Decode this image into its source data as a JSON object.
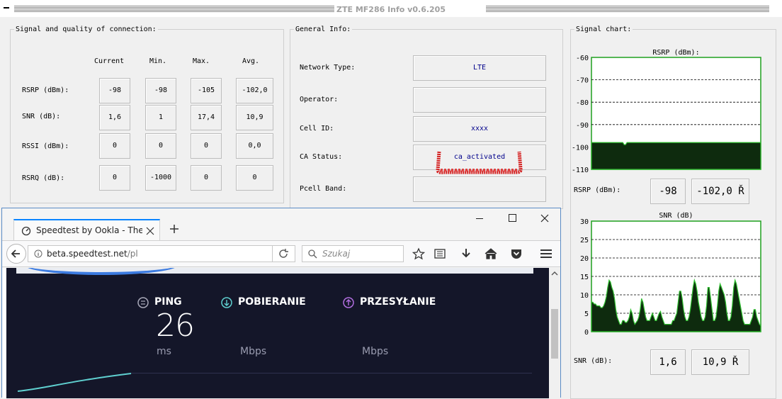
{
  "app": {
    "title": "ZTE MF286 Info v0.6.205"
  },
  "signal_group": {
    "title": "Signal and quality of connection:",
    "columns": [
      "Current",
      "Min.",
      "Max.",
      "Avg."
    ],
    "rows": [
      {
        "label": "RSRP (dBm):",
        "values": [
          "-98",
          "-98",
          "-105",
          "-102,0"
        ]
      },
      {
        "label": "SNR (dB):",
        "values": [
          "1,6",
          "1",
          "17,4",
          "10,9"
        ]
      },
      {
        "label": "RSSI (dBm):",
        "values": [
          "0",
          "0",
          "0",
          "0,0"
        ]
      },
      {
        "label": "RSRQ (dB):",
        "values": [
          "0",
          "-1000",
          "0",
          "0"
        ]
      }
    ]
  },
  "general_group": {
    "title": "General Info:",
    "fields": [
      {
        "label": "Network Type:",
        "value": "LTE"
      },
      {
        "label": "Operator:",
        "value": ""
      },
      {
        "label": "Cell ID:",
        "value": "xxxx"
      },
      {
        "label": "CA Status:",
        "value": "ca_activated"
      },
      {
        "label": "Pcell Band:",
        "value": ""
      }
    ]
  },
  "chart_group": {
    "title": "Signal chart:",
    "rsrp_row": {
      "label": "RSRP (dBm):",
      "current": "-98",
      "avg": "-102,0 Ř"
    },
    "snr_row": {
      "label": "SNR (dB):",
      "current": "1,6",
      "avg": "10,9 Ř"
    }
  },
  "chart_data": [
    {
      "type": "area",
      "title": "RSRP (dBm):",
      "ylim": [
        -110,
        -60
      ],
      "y_ticks": [
        "-60",
        "-70",
        "-80",
        "-90",
        "-100",
        "-110"
      ],
      "y_tick_values": [
        -60,
        -70,
        -80,
        -90,
        -100,
        -110
      ],
      "grid": "dashed",
      "fill_color": "#0e2b0e",
      "line_color": "#2fbf2f",
      "values": [
        -98,
        -98,
        -98,
        -98,
        -98,
        -98,
        -98,
        -98,
        -98,
        -98,
        -98,
        -98,
        -98,
        -98,
        -98,
        -98,
        -98,
        -98,
        -98,
        -98,
        -98,
        -98,
        -98,
        -99,
        -99,
        -98,
        -98,
        -98,
        -98,
        -98,
        -98,
        -98,
        -98,
        -98,
        -98,
        -98,
        -98,
        -98,
        -98,
        -98,
        -98,
        -98,
        -98,
        -98,
        -98,
        -98,
        -98,
        -98,
        -98,
        -98,
        -98,
        -98,
        -98,
        -98,
        -98,
        -98,
        -98,
        -98,
        -98,
        -98,
        -98,
        -98,
        -98,
        -98,
        -98,
        -98,
        -98,
        -98,
        -98,
        -98,
        -98,
        -98,
        -98,
        -98,
        -98,
        -98,
        -98,
        -98,
        -98,
        -98,
        -98,
        -98,
        -98,
        -98,
        -98,
        -98,
        -98,
        -98,
        -98,
        -98,
        -98,
        -98,
        -98,
        -98,
        -98,
        -98,
        -98,
        -98,
        -98,
        -98,
        -98,
        -98,
        -98,
        -98,
        -98,
        -98,
        -98,
        -98,
        -98,
        -98,
        -98,
        -98,
        -98,
        -98,
        -98,
        -98,
        -98,
        -98,
        -98,
        -98
      ]
    },
    {
      "type": "area",
      "title": "SNR (dB)",
      "ylim": [
        0,
        30
      ],
      "y_ticks": [
        "30",
        "25",
        "20",
        "15",
        "10",
        "5",
        "0"
      ],
      "y_tick_values": [
        30,
        25,
        20,
        15,
        10,
        5,
        0
      ],
      "grid": "dashed",
      "fill_color": "#0e2b0e",
      "line_color": "#2fbf2f",
      "values": [
        8,
        8,
        7.5,
        7.5,
        7,
        7,
        7,
        6.5,
        6.5,
        7,
        8,
        9.5,
        12,
        14,
        13.5,
        12,
        11,
        9,
        6,
        4,
        3,
        2,
        2,
        3,
        3,
        2.5,
        2.5,
        3,
        4,
        6,
        5,
        3,
        2,
        2.5,
        3,
        4,
        6,
        9,
        8,
        6,
        4,
        3,
        3,
        3,
        4,
        5,
        4,
        3,
        3,
        4,
        5,
        5.5,
        4,
        3,
        2,
        2,
        2,
        2,
        2,
        2,
        3,
        3,
        4,
        5,
        8,
        11,
        11,
        9,
        6,
        4,
        3,
        3,
        4,
        6,
        9,
        12,
        14,
        13,
        11,
        8,
        6,
        4,
        3,
        3,
        4,
        7,
        12,
        12,
        9,
        6,
        3,
        3,
        4,
        7,
        11,
        13,
        12,
        11,
        10,
        8,
        5,
        3,
        3,
        4,
        7,
        12,
        14,
        13,
        11,
        9,
        7,
        5,
        3,
        2,
        2,
        2,
        2,
        2,
        3,
        4,
        6,
        6,
        4,
        3,
        2,
        1.6
      ]
    }
  ],
  "browser": {
    "tab_title": "Speedtest by Ookla - The Gl",
    "url_host": "beta.speedtest.net",
    "url_path": "/pl",
    "search_placeholder": "Szukaj",
    "ping_label": "PING",
    "ping_value": "26",
    "ping_unit": "ms",
    "download_label": "POBIERANIE",
    "download_unit": "Mbps",
    "upload_label": "PRZESYŁANIE",
    "upload_unit": "Mbps",
    "colors": {
      "ping_icon": "#a8a8b8",
      "download_icon": "#5fd0d0",
      "upload_icon": "#b26ee0",
      "page_bg": "#141629"
    }
  }
}
